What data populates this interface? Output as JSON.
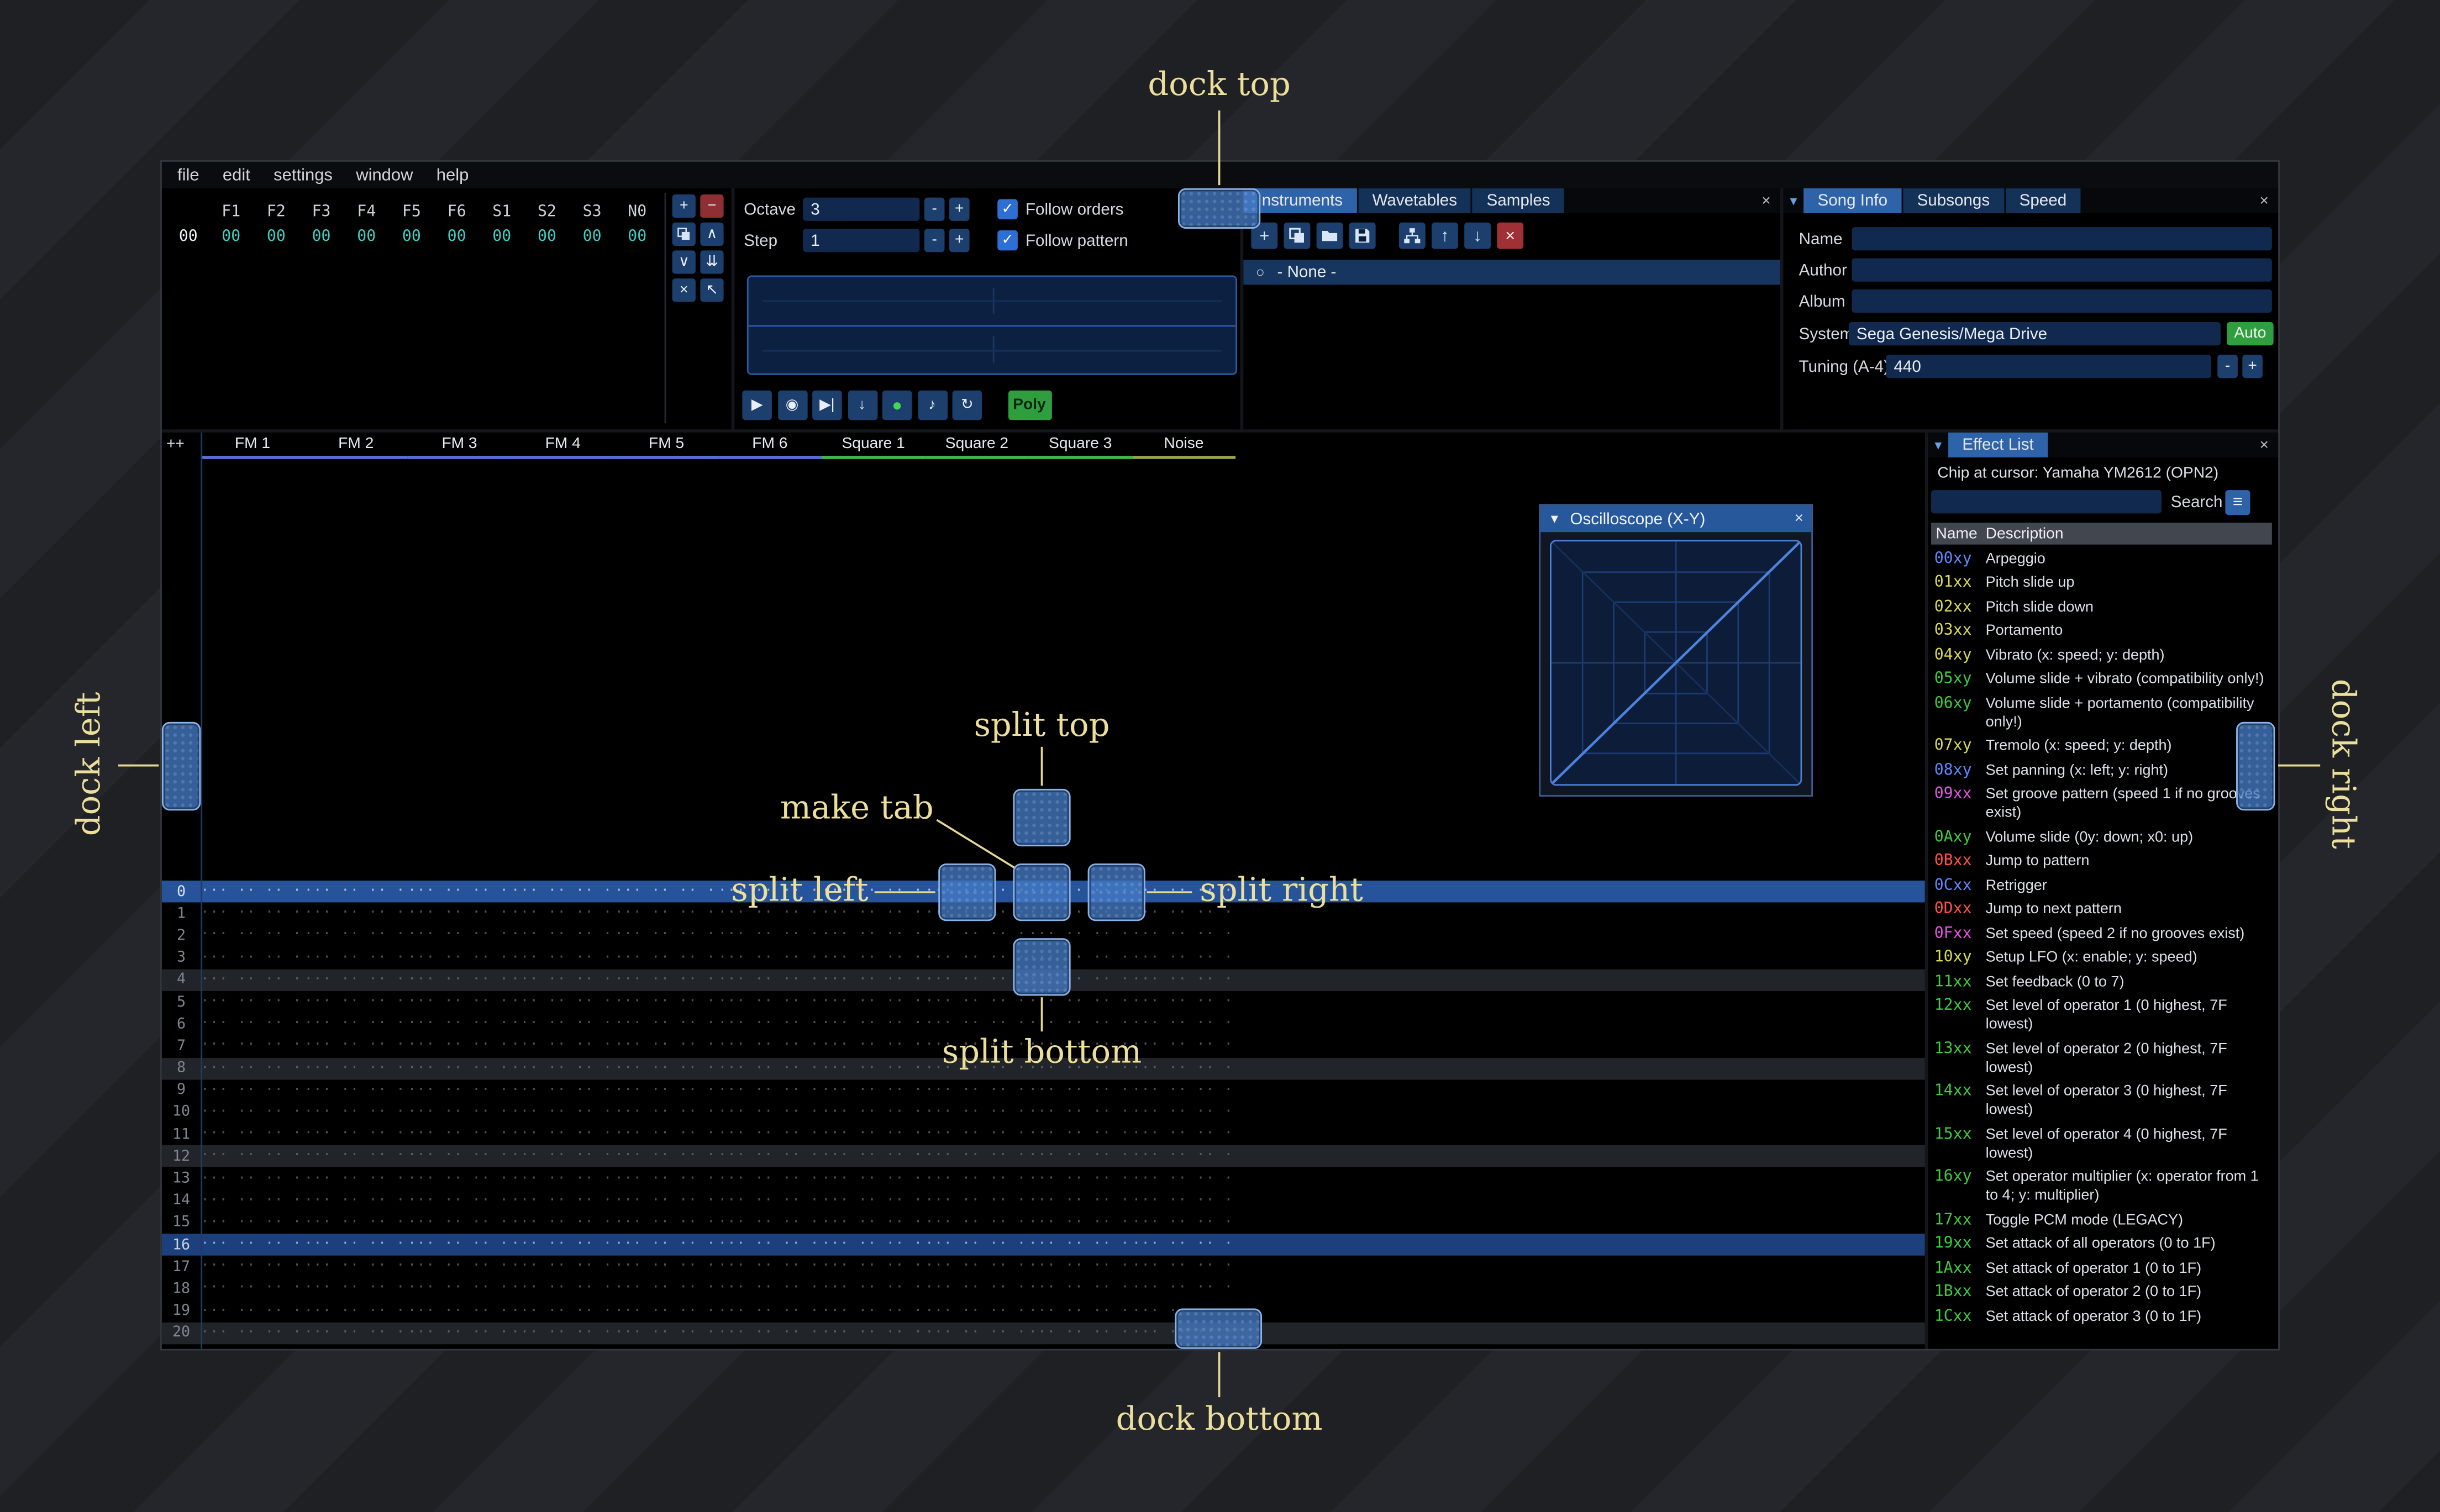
{
  "theme": {
    "accent": "#2e63a9",
    "overlay_label_color": "#ecdf9b",
    "dock_fill": "#4a7cc6",
    "window_bg": "#000000"
  },
  "icons": {
    "close": "×",
    "menu": "≡",
    "radio": "○",
    "check": "✓",
    "collapse": "▼",
    "dropdown": "▾"
  },
  "menu_bar": {
    "items": [
      "file",
      "edit",
      "settings",
      "window",
      "help"
    ]
  },
  "orders": {
    "headers": [
      "F1",
      "F2",
      "F3",
      "F4",
      "F5",
      "F6",
      "S1",
      "S2",
      "S3",
      "N0"
    ],
    "rows": [
      {
        "index": "00",
        "values": [
          "00",
          "00",
          "00",
          "00",
          "00",
          "00",
          "00",
          "00",
          "00",
          "00"
        ]
      }
    ],
    "buttons": [
      {
        "name": "order-add-button",
        "glyph": "+"
      },
      {
        "name": "order-remove-button",
        "glyph": "−",
        "style": "red"
      },
      {
        "name": "order-duplicate-button",
        "icon": "clone"
      },
      {
        "name": "order-move-up-button",
        "glyph": "∧"
      },
      {
        "name": "order-move-down-button",
        "glyph": "∨"
      },
      {
        "name": "order-duplicate-end-button",
        "glyph": "⇊"
      },
      {
        "name": "order-change-all-button",
        "glyph": "×"
      },
      {
        "name": "order-edit-mode-button",
        "glyph": "↖"
      }
    ]
  },
  "controls": {
    "octave_label": "Octave",
    "octave_value": "3",
    "step_label": "Step",
    "step_value": "1",
    "decrease_label": "-",
    "increase_label": "+",
    "follow_orders_label": "Follow orders",
    "follow_orders_checked": true,
    "follow_pattern_label": "Follow pattern",
    "follow_pattern_checked": true,
    "playback": [
      {
        "name": "play-button",
        "glyph": "▶"
      },
      {
        "name": "play-song-button",
        "glyph": "◉"
      },
      {
        "name": "play-from-cursor-button",
        "glyph": "▶|"
      },
      {
        "name": "step-one-row-button",
        "glyph": "↓"
      },
      {
        "name": "edit-record-toggle",
        "glyph": "●",
        "green": true
      },
      {
        "name": "metronome-button",
        "glyph": "♪"
      },
      {
        "name": "repeat-pattern-button",
        "glyph": "↻"
      }
    ],
    "poly_label": "Poly"
  },
  "instruments": {
    "tabs": [
      {
        "label": "Instruments",
        "selected": true
      },
      {
        "label": "Wavetables"
      },
      {
        "label": "Samples"
      }
    ],
    "toolbar": [
      {
        "name": "add-instrument-button",
        "glyph": "+"
      },
      {
        "name": "duplicate-instrument-button",
        "icon": "clone"
      },
      {
        "name": "open-instrument-button",
        "icon": "folder"
      },
      {
        "name": "save-instrument-button",
        "icon": "floppy"
      },
      {
        "name": "instrument-organize-button",
        "icon": "nodes",
        "gap": true
      },
      {
        "name": "move-instrument-up-button",
        "glyph": "↑"
      },
      {
        "name": "move-instrument-down-button",
        "glyph": "↓"
      },
      {
        "name": "delete-instrument-button",
        "glyph": "×",
        "style": "red"
      }
    ],
    "items": [
      {
        "label": "- None -",
        "selected": true
      }
    ]
  },
  "song_info": {
    "tabs": [
      {
        "label": "Song Info",
        "selected": true
      },
      {
        "label": "Subsongs"
      },
      {
        "label": "Speed"
      }
    ],
    "name_label": "Name",
    "name_value": "",
    "author_label": "Author",
    "author_value": "",
    "album_label": "Album",
    "album_value": "",
    "system_label": "System",
    "system_value": "Sega Genesis/Mega Drive",
    "auto_label": "Auto",
    "tuning_label": "Tuning (A-4)",
    "tuning_value": "440"
  },
  "pattern": {
    "corner_label": "++",
    "row_count": 22,
    "empty_cell": "··· ·· ·· ···",
    "channels": [
      {
        "name": "FM 1",
        "color": "#5b6fd9"
      },
      {
        "name": "FM 2",
        "color": "#5b6fd9"
      },
      {
        "name": "FM 3",
        "color": "#5b6fd9"
      },
      {
        "name": "FM 4",
        "color": "#5b6fd9"
      },
      {
        "name": "FM 5",
        "color": "#5b6fd9"
      },
      {
        "name": "FM 6",
        "color": "#5b6fd9"
      },
      {
        "name": "Square 1",
        "color": "#42b84c"
      },
      {
        "name": "Square 2",
        "color": "#42b84c"
      },
      {
        "name": "Square 3",
        "color": "#42b84c"
      },
      {
        "name": "Noise",
        "color": "#9ba24c"
      }
    ]
  },
  "oscilloscope": {
    "title": "Oscilloscope (X-Y)"
  },
  "effect_list": {
    "tabs": [
      {
        "label": "Effect List",
        "selected": true
      }
    ],
    "chip_line": "Chip at cursor: Yamaha YM2612 (OPN2)",
    "search_label": "Search",
    "search_value": "",
    "columns": {
      "name": "Name",
      "description": "Description"
    },
    "colors": {
      "blue": "#6088ff",
      "yellow": "#d9d955",
      "green": "#3fca3f",
      "magenta": "#e455e4",
      "red": "#ff5249"
    },
    "effects": [
      {
        "code": "00xy",
        "color": "blue",
        "desc": "Arpeggio"
      },
      {
        "code": "01xx",
        "color": "yellow",
        "desc": "Pitch slide up"
      },
      {
        "code": "02xx",
        "color": "yellow",
        "desc": "Pitch slide down"
      },
      {
        "code": "03xx",
        "color": "yellow",
        "desc": "Portamento"
      },
      {
        "code": "04xy",
        "color": "yellow",
        "desc": "Vibrato (x: speed; y: depth)"
      },
      {
        "code": "05xy",
        "color": "green",
        "desc": "Volume slide + vibrato (compatibility only!)"
      },
      {
        "code": "06xy",
        "color": "green",
        "desc": "Volume slide + portamento (compatibility only!)"
      },
      {
        "code": "07xy",
        "color": "yellow",
        "desc": "Tremolo (x: speed; y: depth)"
      },
      {
        "code": "08xy",
        "color": "blue",
        "desc": "Set panning (x: left; y: right)"
      },
      {
        "code": "09xx",
        "color": "magenta",
        "desc": "Set groove pattern (speed 1 if no grooves exist)"
      },
      {
        "code": "0Axy",
        "color": "green",
        "desc": "Volume slide (0y: down; x0: up)"
      },
      {
        "code": "0Bxx",
        "color": "red",
        "desc": "Jump to pattern"
      },
      {
        "code": "0Cxx",
        "color": "blue",
        "desc": "Retrigger"
      },
      {
        "code": "0Dxx",
        "color": "red",
        "desc": "Jump to next pattern"
      },
      {
        "code": "0Fxx",
        "color": "magenta",
        "desc": "Set speed (speed 2 if no grooves exist)"
      },
      {
        "code": "10xy",
        "color": "yellow",
        "desc": "Setup LFO (x: enable; y: speed)"
      },
      {
        "code": "11xx",
        "color": "green",
        "desc": "Set feedback (0 to 7)"
      },
      {
        "code": "12xx",
        "color": "green",
        "desc": "Set level of operator 1 (0 highest, 7F lowest)"
      },
      {
        "code": "13xx",
        "color": "green",
        "desc": "Set level of operator 2 (0 highest, 7F lowest)"
      },
      {
        "code": "14xx",
        "color": "green",
        "desc": "Set level of operator 3 (0 highest, 7F lowest)"
      },
      {
        "code": "15xx",
        "color": "green",
        "desc": "Set level of operator 4 (0 highest, 7F lowest)"
      },
      {
        "code": "16xy",
        "color": "green",
        "desc": "Set operator multiplier (x: operator from 1 to 4; y: multiplier)"
      },
      {
        "code": "17xx",
        "color": "green",
        "desc": "Toggle PCM mode (LEGACY)"
      },
      {
        "code": "19xx",
        "color": "green",
        "desc": "Set attack of all operators (0 to 1F)"
      },
      {
        "code": "1Axx",
        "color": "green",
        "desc": "Set attack of operator 1 (0 to 1F)"
      },
      {
        "code": "1Bxx",
        "color": "green",
        "desc": "Set attack of operator 2 (0 to 1F)"
      },
      {
        "code": "1Cxx",
        "color": "green",
        "desc": "Set attack of operator 3 (0 to 1F)"
      }
    ]
  },
  "overlay": {
    "dock_top": "dock top",
    "dock_bottom": "dock bottom",
    "dock_left": "dock left",
    "dock_right": "dock right",
    "split_top": "split top",
    "split_bottom": "split bottom",
    "split_left": "split left",
    "split_right": "split right",
    "make_tab": "make tab"
  }
}
